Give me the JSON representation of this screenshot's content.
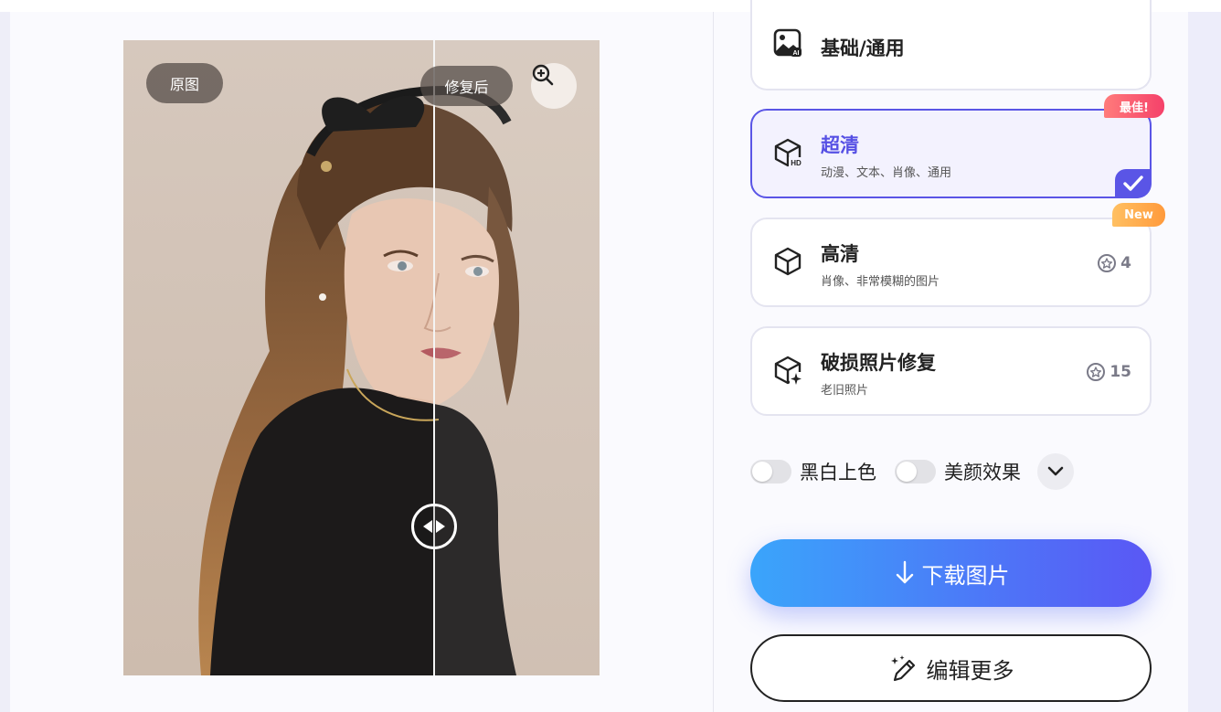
{
  "compare": {
    "before_label": "原图",
    "after_label": "修复后",
    "zoom_icon": "zoom-in-icon",
    "split_handle_icon": "left-right-arrows-icon"
  },
  "modes": [
    {
      "title": "基础/通用",
      "subtitle": "",
      "cost": "",
      "icon": "ai-image-icon",
      "selected": false
    },
    {
      "title": "超清",
      "subtitle": "动漫、文本、肖像、通用",
      "cost": "",
      "icon": "hd-cube-icon",
      "selected": true,
      "badge": "最佳!"
    },
    {
      "title": "高清",
      "subtitle": "肖像、非常模糊的图片",
      "cost": "4",
      "icon": "cube-icon",
      "selected": false,
      "badge": "New"
    },
    {
      "title": "破损照片修复",
      "subtitle": "老旧照片",
      "cost": "15",
      "icon": "cube-sparkle-icon",
      "selected": false
    }
  ],
  "options": {
    "colorize_label": "黑白上色",
    "beautify_label": "美颜效果",
    "colorize_on": false,
    "beautify_on": false
  },
  "actions": {
    "download_label": "下载图片",
    "edit_more_label": "编辑更多"
  },
  "colors": {
    "accent": "#5a55e6",
    "download_gradient_start": "#3aa5fb",
    "download_gradient_end": "#5a57f5",
    "badge_best": "#f5416a",
    "badge_new": "#ff9a3c"
  }
}
